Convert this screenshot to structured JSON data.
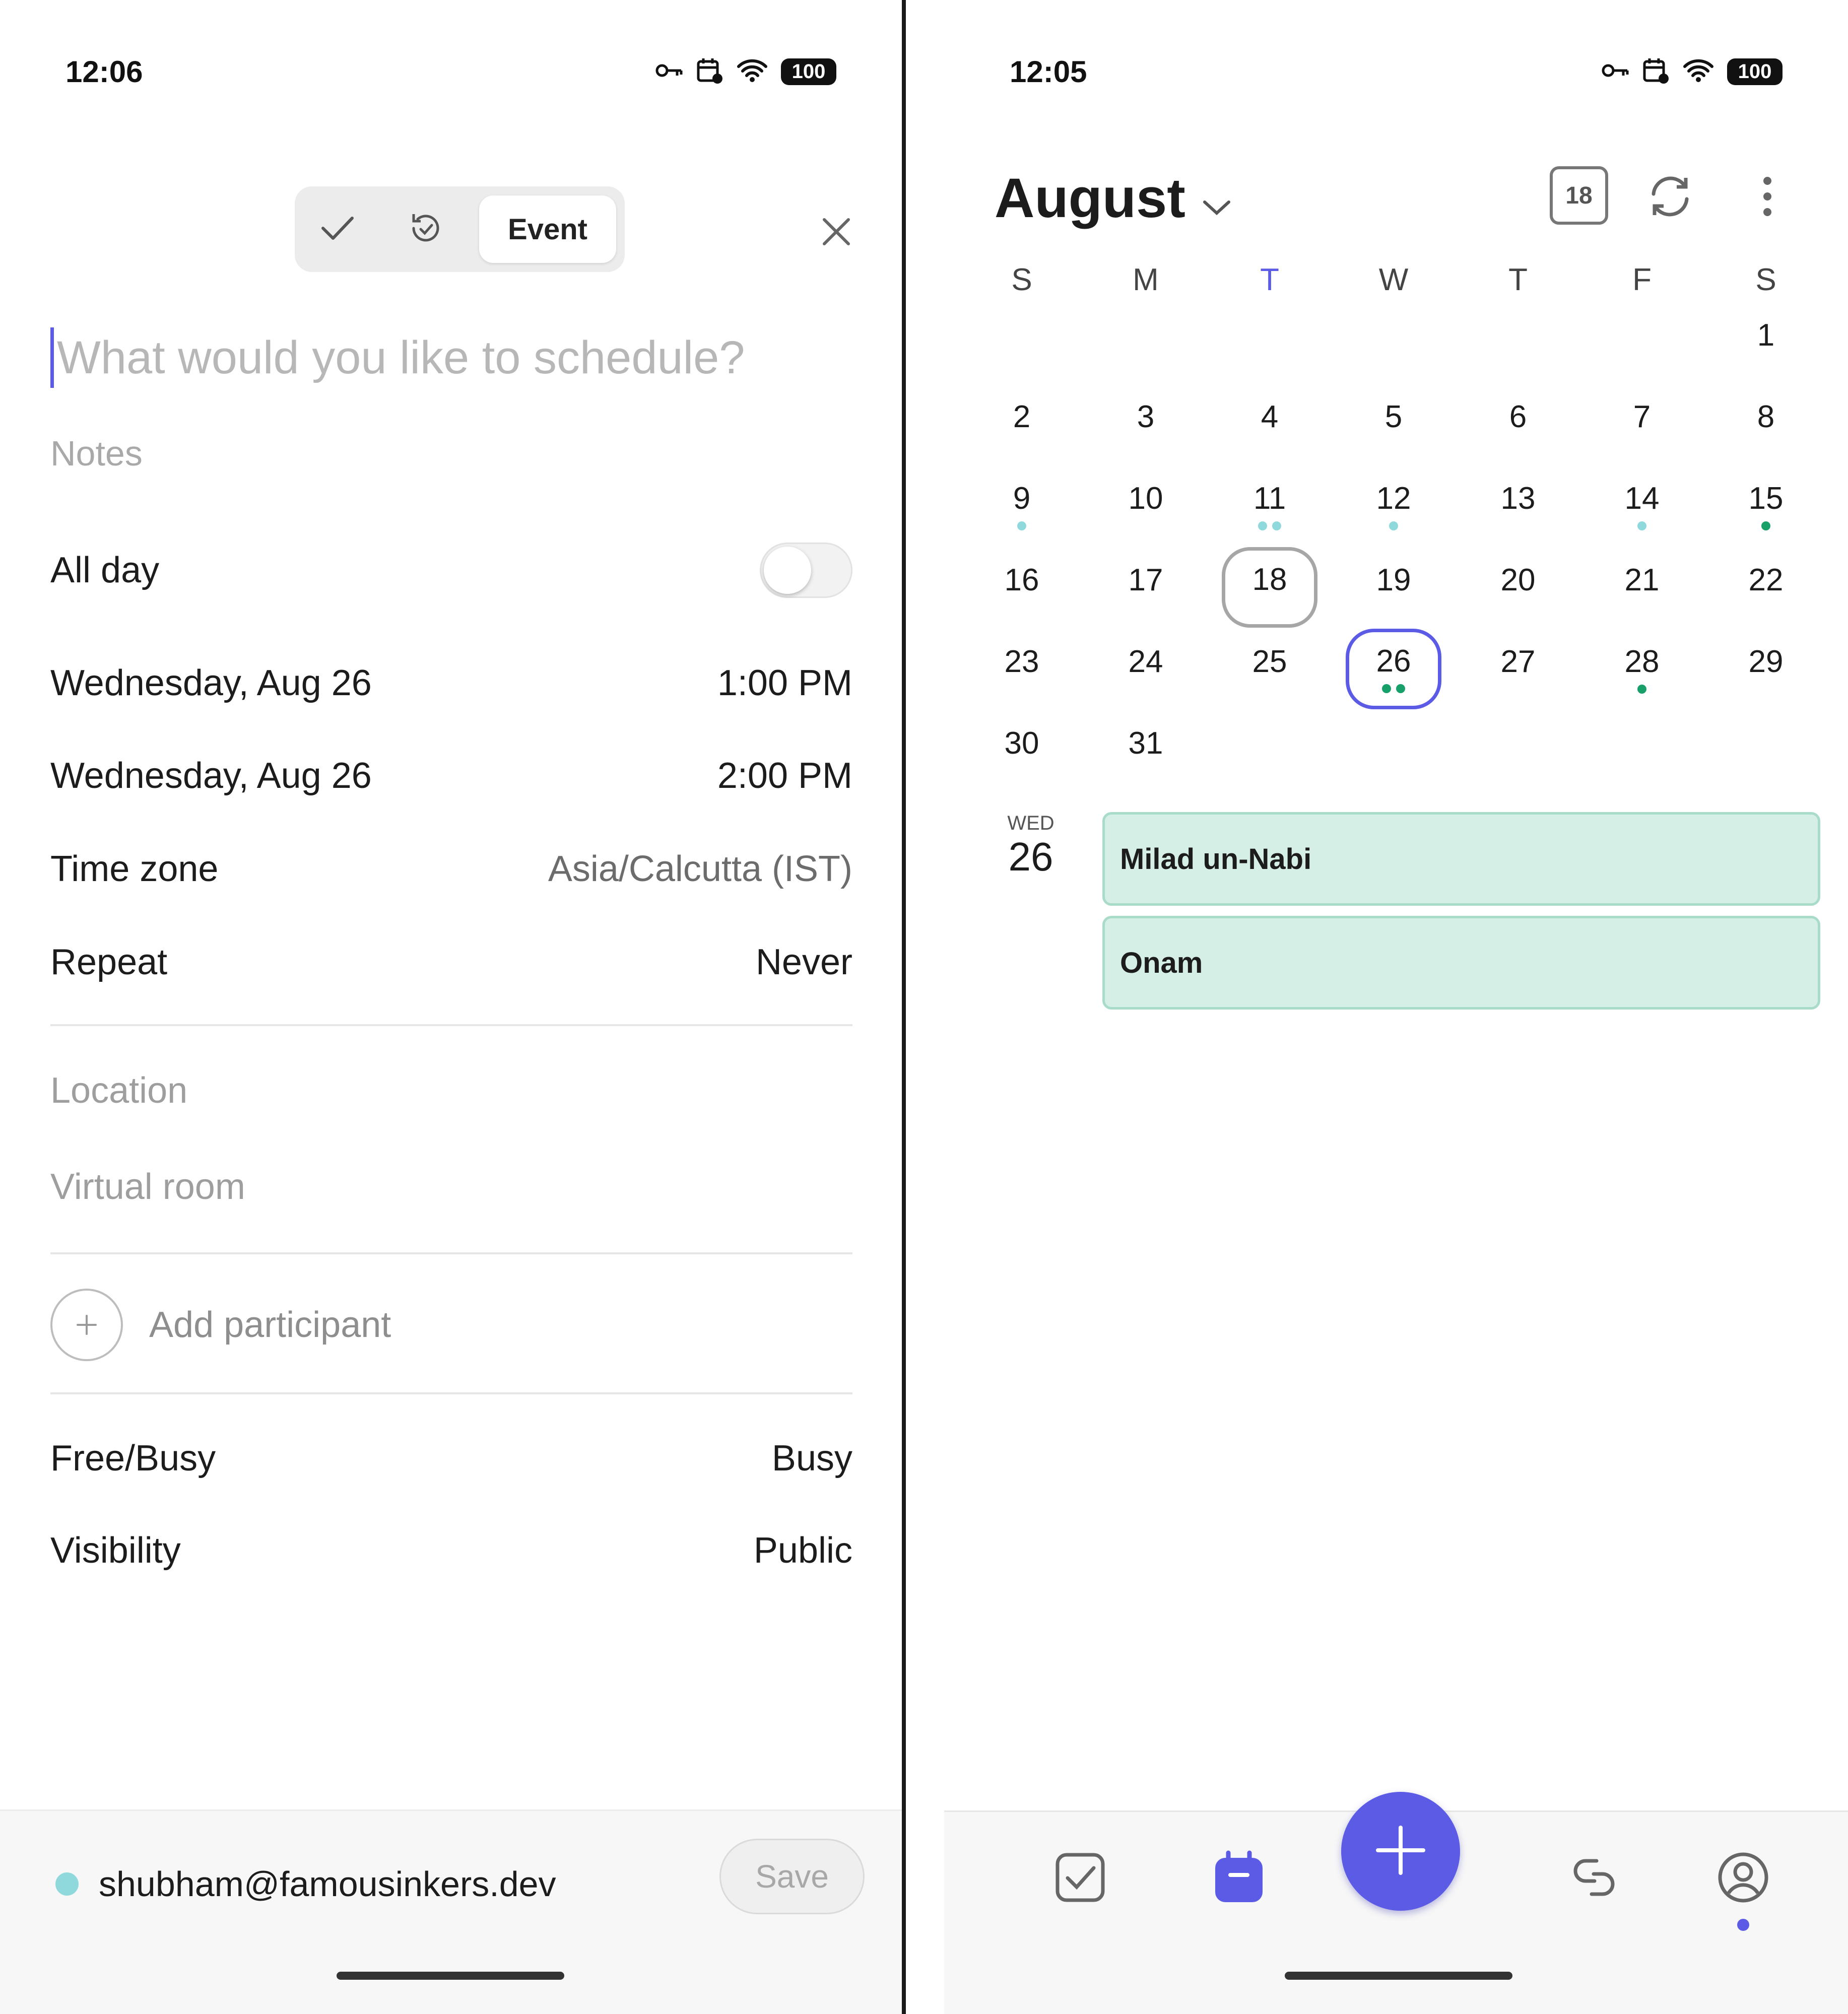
{
  "left": {
    "status": {
      "time": "12:06",
      "battery": "100"
    },
    "segments": {
      "selected_label": "Event",
      "options": [
        "check-icon",
        "history-icon",
        "Event"
      ]
    },
    "title_placeholder": "What would you like to schedule?",
    "notes_placeholder": "Notes",
    "all_day": {
      "label": "All day",
      "on": false
    },
    "start": {
      "date": "Wednesday, Aug 26",
      "time": "1:00 PM"
    },
    "end": {
      "date": "Wednesday, Aug 26",
      "time": "2:00 PM"
    },
    "timezone": {
      "label": "Time zone",
      "value": "Asia/Calcutta (IST)"
    },
    "repeat": {
      "label": "Repeat",
      "value": "Never"
    },
    "location_placeholder": "Location",
    "virtual_room_placeholder": "Virtual room",
    "add_participant": "Add participant",
    "free_busy": {
      "label": "Free/Busy",
      "value": "Busy"
    },
    "visibility": {
      "label": "Visibility",
      "value": "Public"
    },
    "account": "shubham@famousinkers.dev",
    "save_label": "Save"
  },
  "right": {
    "status": {
      "time": "12:05",
      "battery": "100"
    },
    "month": "August",
    "today_badge": "18",
    "weekdays": [
      "S",
      "M",
      "T",
      "W",
      "T",
      "F",
      "S"
    ],
    "today_weekday_index": 2,
    "days": [
      {
        "n": "1",
        "dots": []
      },
      {
        "n": "2",
        "dots": []
      },
      {
        "n": "3",
        "dots": []
      },
      {
        "n": "4",
        "dots": []
      },
      {
        "n": "5",
        "dots": []
      },
      {
        "n": "6",
        "dots": []
      },
      {
        "n": "7",
        "dots": []
      },
      {
        "n": "8",
        "dots": []
      },
      {
        "n": "9",
        "dots": [
          "#8fd9dc"
        ]
      },
      {
        "n": "10",
        "dots": []
      },
      {
        "n": "11",
        "dots": [
          "#8fd9dc",
          "#8fd9dc"
        ]
      },
      {
        "n": "12",
        "dots": [
          "#8fd9dc"
        ]
      },
      {
        "n": "13",
        "dots": []
      },
      {
        "n": "14",
        "dots": [
          "#8fd9dc"
        ]
      },
      {
        "n": "15",
        "dots": [
          "#17a06a"
        ]
      },
      {
        "n": "16",
        "dots": []
      },
      {
        "n": "17",
        "dots": []
      },
      {
        "n": "18",
        "dots": [],
        "today": true
      },
      {
        "n": "19",
        "dots": []
      },
      {
        "n": "20",
        "dots": []
      },
      {
        "n": "21",
        "dots": []
      },
      {
        "n": "22",
        "dots": []
      },
      {
        "n": "23",
        "dots": []
      },
      {
        "n": "24",
        "dots": []
      },
      {
        "n": "25",
        "dots": []
      },
      {
        "n": "26",
        "dots": [
          "#17a06a",
          "#17a06a"
        ],
        "selected": true
      },
      {
        "n": "27",
        "dots": []
      },
      {
        "n": "28",
        "dots": [
          "#17a06a"
        ]
      },
      {
        "n": "29",
        "dots": []
      },
      {
        "n": "30",
        "dots": []
      },
      {
        "n": "31",
        "dots": []
      }
    ],
    "first_weekday_index": 6,
    "agenda": {
      "weekday": "WED",
      "day": "26",
      "events": [
        "Milad un-Nabi",
        "Onam"
      ]
    },
    "nav": [
      "tasks-icon",
      "calendar-icon",
      "add-icon",
      "link-icon",
      "profile-icon"
    ],
    "colors": {
      "accent": "#5b5be6",
      "event_bg": "#d6efe6",
      "dot_light": "#8fd9dc",
      "dot_green": "#17a06a"
    }
  }
}
